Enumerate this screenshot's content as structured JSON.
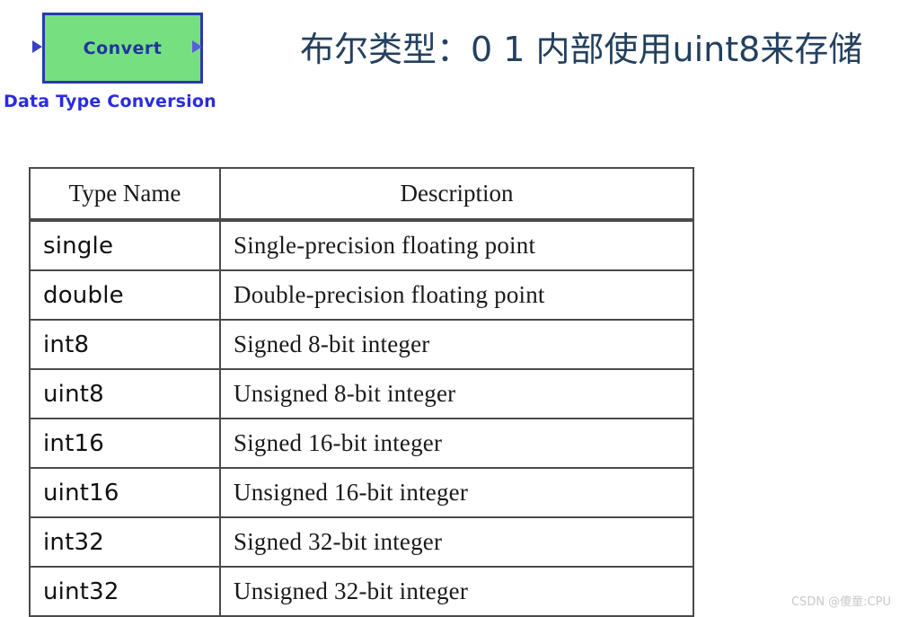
{
  "heading": {
    "text": "布尔类型：0 1 内部使用uint8来存储"
  },
  "simulink_block": {
    "block_label": "Convert",
    "caption": "Data Type Conversion",
    "fill_color": "#76e081",
    "border_color": "#2b36b5",
    "label_color": "#22349c",
    "caption_color": "#2b2be0",
    "input_port_icon": "arrow-right-icon",
    "output_port_icon": "arrow-right-icon"
  },
  "table": {
    "headers": [
      "Type Name",
      "Description"
    ],
    "rows": [
      {
        "name": "single",
        "description": "Single-precision floating point"
      },
      {
        "name": "double",
        "description": "Double-precision floating point"
      },
      {
        "name": "int8",
        "description": "Signed 8-bit integer"
      },
      {
        "name": "uint8",
        "description": "Unsigned 8-bit integer"
      },
      {
        "name": "int16",
        "description": "Signed 16-bit integer"
      },
      {
        "name": "uint16",
        "description": "Unsigned 16-bit integer"
      },
      {
        "name": "int32",
        "description": "Signed 32-bit integer"
      },
      {
        "name": "uint32",
        "description": "Unsigned 32-bit integer"
      }
    ]
  },
  "watermark": {
    "text": "CSDN @傻童:CPU"
  }
}
